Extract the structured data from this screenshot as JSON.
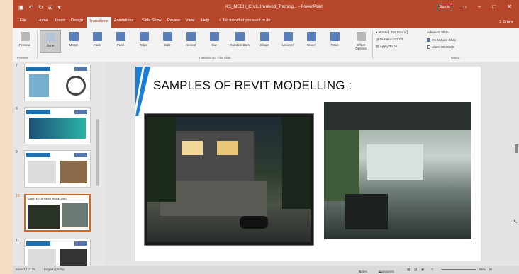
{
  "app": {
    "window_title": "KS_MECH_CIVIL Involved_Training... - PowerPoint",
    "sign_in": "Sign in",
    "share": "Share"
  },
  "tabs": [
    {
      "label": "File"
    },
    {
      "label": "Home"
    },
    {
      "label": "Insert"
    },
    {
      "label": "Design"
    },
    {
      "label": "Transitions",
      "active": true
    },
    {
      "label": "Animations"
    },
    {
      "label": "Slide Show"
    },
    {
      "label": "Review"
    },
    {
      "label": "View"
    },
    {
      "label": "Help"
    },
    {
      "label": "Tell me what you want to do"
    }
  ],
  "ribbon": {
    "preview": "Preview",
    "transitions": [
      "None",
      "Morph",
      "Fade",
      "Push",
      "Wipe",
      "Split",
      "Reveal",
      "Cut",
      "Random Bars",
      "Shape",
      "Uncover",
      "Cover",
      "Flash"
    ],
    "effect_options": "Effect Options",
    "group_preview": "Preview",
    "group_transition": "Transition to This Slide",
    "group_timing": "Timing",
    "sound_label": "Sound:",
    "sound_value": "[No Sound]",
    "duration_label": "Duration:",
    "duration_value": "02.00",
    "apply_all": "Apply To All",
    "advance_slide": "Advance Slide",
    "on_mouse_click": "On Mouse Click",
    "after_label": "After:",
    "after_value": "00:00.00"
  },
  "thumbnails": [
    {
      "num": "7"
    },
    {
      "num": "8"
    },
    {
      "num": "9"
    },
    {
      "num": "10",
      "title": "SAMPLES OF REVIT MODELLING",
      "active": true
    },
    {
      "num": "11"
    }
  ],
  "slide": {
    "title": "SAMPLES OF REVIT MODELLING :"
  },
  "status": {
    "slide_info": "Slide 10 of 20",
    "language": "English (India)",
    "notes": "Notes",
    "comments": "Comments",
    "zoom": "65%"
  },
  "colors": {
    "accent": "#b7472a",
    "stripe_blue": "#1a7fd4"
  }
}
